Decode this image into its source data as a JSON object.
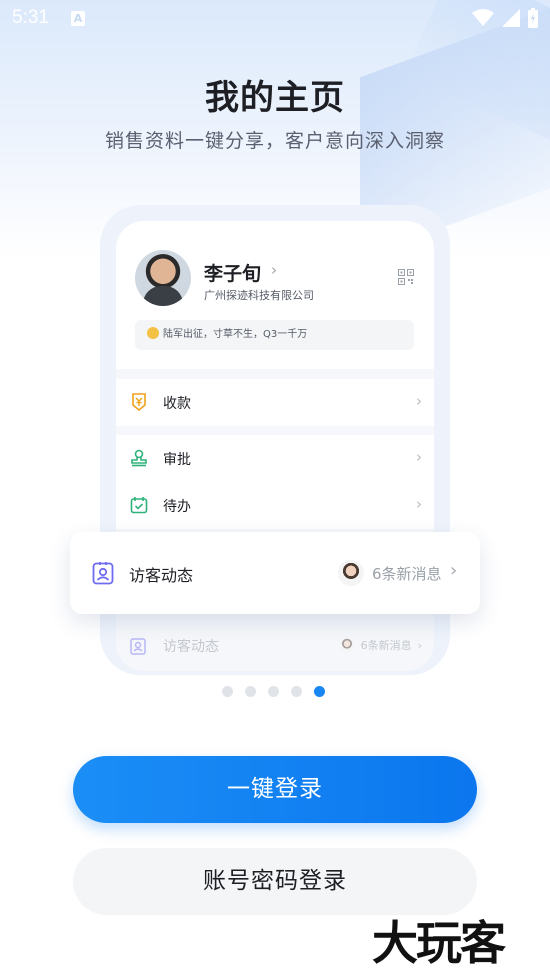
{
  "status_bar": {
    "time": "5:31",
    "notification_letter": "A"
  },
  "header": {
    "title": "我的主页",
    "subtitle": "销售资料一键分享，客户意向深入洞察"
  },
  "profile": {
    "name": "李子旬",
    "company": "广州探迹科技有限公司",
    "motto": "陆军出征，寸草不生，Q3一千万"
  },
  "menu": {
    "payment": "收款",
    "approval": "审批",
    "todo": "待办"
  },
  "visitor": {
    "label": "访客动态",
    "messages": "6条新消息"
  },
  "carousel": {
    "total": 5,
    "active_index": 4
  },
  "buttons": {
    "one_click_login": "一键登录",
    "password_login": "账号密码登录"
  },
  "watermark": "大玩客",
  "colors": {
    "primary": "#1a86f2",
    "approval_green": "#2fb27a",
    "payment_orange": "#f0a21c",
    "visitor_purple": "#6f6cf2"
  }
}
